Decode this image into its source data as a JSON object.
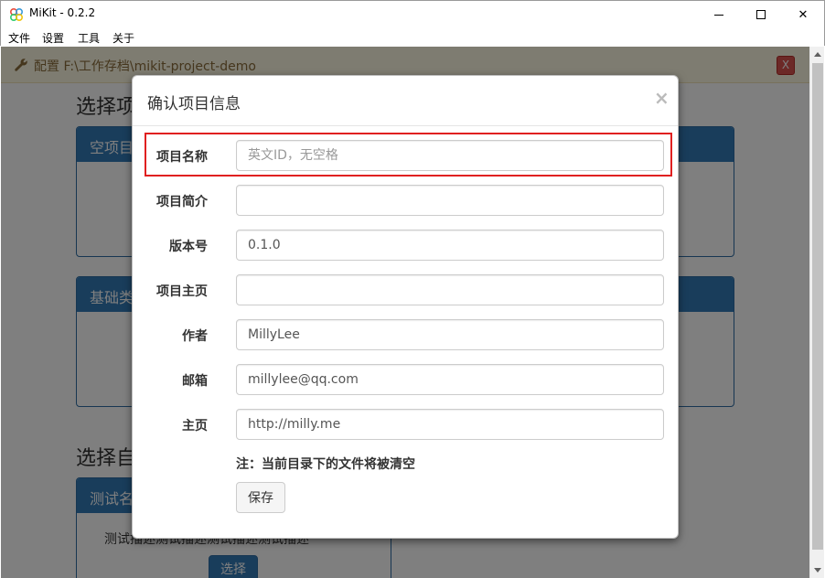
{
  "window": {
    "title": "MiKit - 0.2.2",
    "minimize_glyph": "",
    "maximize_glyph": "",
    "close_glyph": "✕"
  },
  "menu": {
    "items": [
      "文件",
      "设置",
      "工具",
      "关于"
    ]
  },
  "config_bar": {
    "icon": "wrench-icon",
    "text": "配置 F:\\工作存档\\mikit-project-demo",
    "close_label": "X"
  },
  "background": {
    "heading_1": "选择项",
    "panel_1_title": "空项目",
    "panel_2_title": "基础类",
    "heading_2": "选择自",
    "panel_3_title": "测试名",
    "panel_3_body": "测试描述测试描述测试描述测试描述",
    "panel_3_button": "选择"
  },
  "modal": {
    "title": "确认项目信息",
    "close_glyph": "×",
    "fields": [
      {
        "label": "项目名称",
        "value": "",
        "placeholder": "英文ID，无空格"
      },
      {
        "label": "项目简介",
        "value": "",
        "placeholder": ""
      },
      {
        "label": "版本号",
        "value": "0.1.0",
        "placeholder": ""
      },
      {
        "label": "项目主页",
        "value": "",
        "placeholder": ""
      },
      {
        "label": "作者",
        "value": "MillyLee",
        "placeholder": ""
      },
      {
        "label": "邮箱",
        "value": "millylee@qq.com",
        "placeholder": ""
      },
      {
        "label": "主页",
        "value": "http://milly.me",
        "placeholder": ""
      }
    ],
    "note": "注：当前目录下的文件将被清空",
    "save_label": "保存"
  },
  "colors": {
    "primary": "#337ab7",
    "warning_bg": "#fcf8e3",
    "warning_text": "#8a6d3b",
    "danger": "#d9534f",
    "highlight": "#e02020"
  }
}
